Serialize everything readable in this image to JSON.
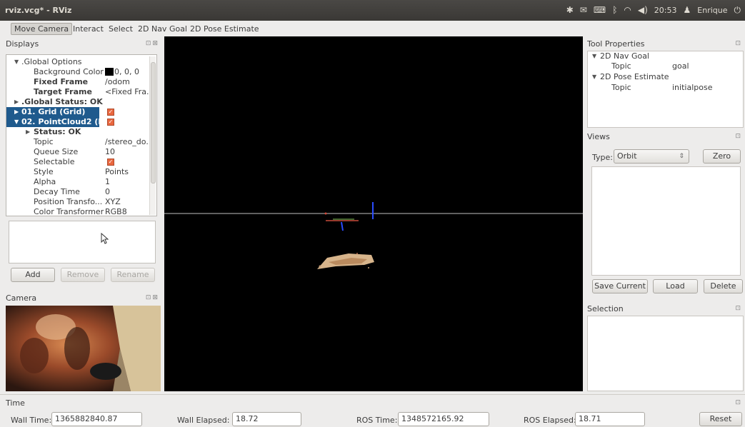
{
  "window": {
    "title": "rviz.vcg* - RViz"
  },
  "tray": {
    "time": "20:53",
    "user": "Enrique"
  },
  "toolbar": {
    "move_camera": "Move Camera",
    "interact": "Interact",
    "select": "Select",
    "nav_goal": "2D Nav Goal",
    "pose_estimate": "2D Pose Estimate"
  },
  "displays": {
    "title": "Displays",
    "rows": [
      {
        "label": ".Global Options"
      },
      {
        "label": "Background Color",
        "value": "0, 0, 0"
      },
      {
        "label": "Fixed Frame",
        "value": "/odom"
      },
      {
        "label": "Target Frame",
        "value": "<Fixed Fra..."
      },
      {
        "label": ".Global Status: OK"
      },
      {
        "label": "01. Grid (Grid)"
      },
      {
        "label": "02. PointCloud2 (P..."
      },
      {
        "label": "Status: OK"
      },
      {
        "label": "Topic",
        "value": "/stereo_do..."
      },
      {
        "label": "Queue Size",
        "value": "10"
      },
      {
        "label": "Selectable"
      },
      {
        "label": "Style",
        "value": "Points"
      },
      {
        "label": "Alpha",
        "value": "1"
      },
      {
        "label": "Decay Time",
        "value": "0"
      },
      {
        "label": "Position Transfo...",
        "value": "XYZ"
      },
      {
        "label": "Color Transformer",
        "value": "RGB8"
      }
    ],
    "add": "Add",
    "remove": "Remove",
    "rename": "Rename"
  },
  "camera": {
    "title": "Camera"
  },
  "tool_properties": {
    "title": "Tool Properties",
    "nav_goal": "2D Nav Goal",
    "topic_label": "Topic",
    "goal_topic": "goal",
    "pose_estimate": "2D Pose Estimate",
    "pose_topic": "initialpose"
  },
  "views": {
    "title": "Views",
    "type_label": "Type:",
    "type_value": "Orbit",
    "zero": "Zero",
    "save_current": "Save Current",
    "load": "Load",
    "delete": "Delete"
  },
  "selection": {
    "title": "Selection"
  },
  "time": {
    "title": "Time",
    "wall_time_label": "Wall Time:",
    "wall_time": "1365882840.87",
    "wall_elapsed_label": "Wall Elapsed:",
    "wall_elapsed": "18.72",
    "ros_time_label": "ROS Time:",
    "ros_time": "1348572165.92",
    "ros_elapsed_label": "ROS Elapsed:",
    "ros_elapsed": "18.71",
    "reset": "Reset"
  },
  "colors": {
    "selection_blue": "#1f5a8d",
    "checkbox_orange": "#e9673f"
  }
}
